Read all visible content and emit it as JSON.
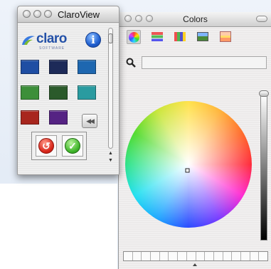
{
  "claroview": {
    "title": "ClaroView",
    "logo_text": "claro",
    "logo_subtext": "SOFTWARE",
    "info_icon": "i",
    "swatches": [
      {
        "name": "blue",
        "color": "#1f4ea3"
      },
      {
        "name": "navy",
        "color": "#1d2a58"
      },
      {
        "name": "steel-blue",
        "color": "#1e67b0"
      },
      {
        "name": "green",
        "color": "#3d8f3a"
      },
      {
        "name": "dark-green",
        "color": "#2b5a2b"
      },
      {
        "name": "teal",
        "color": "#2a9ba0"
      },
      {
        "name": "red",
        "color": "#a8261e"
      },
      {
        "name": "purple",
        "color": "#552383"
      }
    ],
    "rewind_icon": "◀◀",
    "cancel_icon": "↺",
    "ok_icon": "✓"
  },
  "colors_panel": {
    "title": "Colors",
    "toolbar": [
      "color-wheel-icon",
      "color-sliders-icon",
      "color-palettes-icon",
      "image-palettes-icon",
      "crayons-icon"
    ],
    "search_value": "",
    "swatch_slots": 16
  }
}
